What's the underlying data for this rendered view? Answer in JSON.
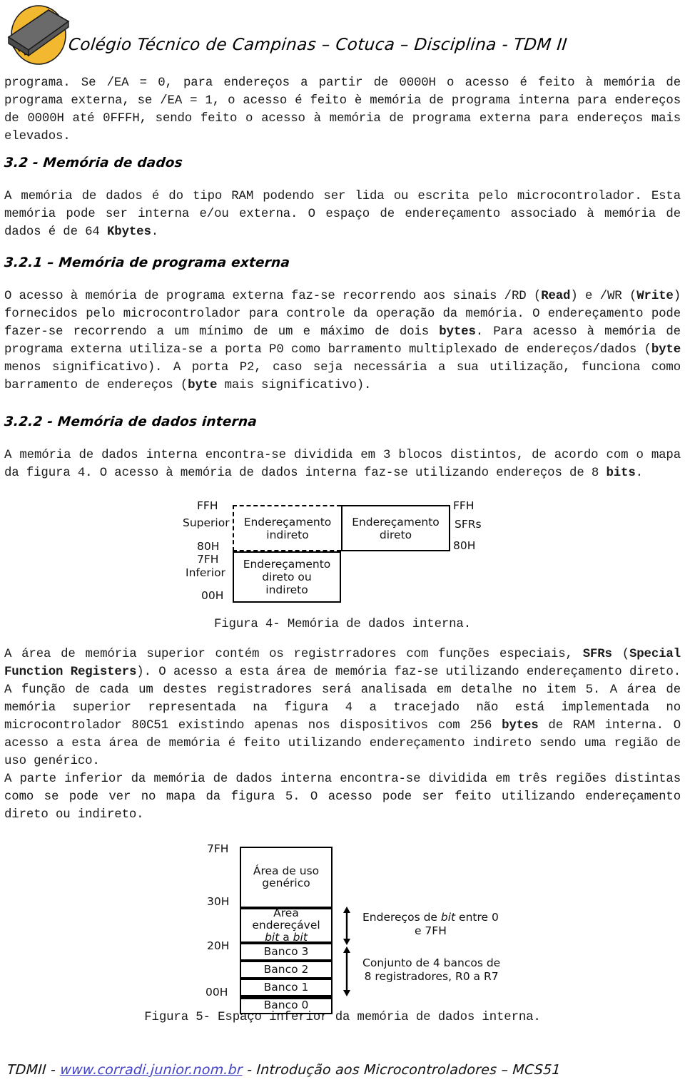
{
  "header": {
    "institution_title": "Colégio Técnico de Campinas – Cotuca – Disciplina - TDM II",
    "logo_icon": "microcontroller-chip-icon",
    "logo_colors": {
      "circle": "#F2B830",
      "chip_body": "#585858",
      "chip_pins": "#FFFFFF"
    }
  },
  "body": {
    "paragraph_1": "programa. Se /EA = 0, para endereços a partir de 0000H o acesso é feito à memória de programa externa, se /EA = 1, o acesso é feito è memória de programa interna para endereços de 0000H até 0FFFH, sendo feito o acesso à memória de programa externa para endereços mais elevados.",
    "section_3_2_heading": "3.2 - Memória de dados",
    "paragraph_2_a": "A memória de dados é do tipo RAM podendo ser lida ou escrita pelo microcontrolador. Esta memória pode ser interna e/ou externa. O espaço de endereçamento associado à memória de dados é de 64 ",
    "paragraph_2_bold": "Kbytes",
    "paragraph_2_b": ".",
    "section_3_2_1_heading": "3.2.1 – Memória de programa externa",
    "paragraph_3_1": "O acesso à memória de programa externa faz-se recorrendo aos sinais /RD (",
    "paragraph_3_b1": "Read",
    "paragraph_3_2": ") e /WR (",
    "paragraph_3_b2": "Write",
    "paragraph_3_3": ") fornecidos pelo microcontrolador para controle da operação da memória. O endereçamento pode fazer-se recorrendo a um mínimo de um e máximo de dois ",
    "paragraph_3_b3": "bytes",
    "paragraph_3_4": ". Para acesso à memória de programa externa utiliza-se a porta P0 como barramento multiplexado de endereços/dados (",
    "paragraph_3_b4": "byte",
    "paragraph_3_5": " menos significativo). A porta P2, caso seja necessária a sua utilização, funciona como barramento de endereços (",
    "paragraph_3_b5": "byte",
    "paragraph_3_6": " mais significativo).",
    "section_3_2_2_heading": "3.2.2 - Memória de dados interna",
    "paragraph_4_1": "A memória de dados interna encontra-se dividida em 3 blocos distintos, de acordo com o mapa da figura 4. O acesso à memória de dados interna faz-se utilizando endereços de 8 ",
    "paragraph_4_b1": "bits",
    "paragraph_4_2": ".",
    "figure_4_caption": "Figura 4- Memória de dados interna.",
    "paragraph_5_1": "A área de memória superior contém os registrradores com funções especiais, ",
    "paragraph_5_b1": "SFRs",
    "paragraph_5_2": " (",
    "paragraph_5_b2": "Special Function Registers",
    "paragraph_5_3": "). O acesso a esta área de memória faz-se utilizando endereçamento direto. A função de cada um destes registradores será analisada em detalhe no item 5. A área de memória superior representada na figura 4 a tracejado não está implementada no microcontrolador 80C51 existindo apenas nos dispositivos com 256 ",
    "paragraph_5_b3": "bytes",
    "paragraph_5_4": " de RAM interna. O acesso a esta área de memória é feito utilizando endereçamento indireto sendo uma região de uso genérico.",
    "paragraph_6": "A parte inferior da memória de dados interna encontra-se dividida em três regiões distintas como se pode ver no mapa da figura 5. O acesso pode ser feito utilizando endereçamento direto ou indireto.",
    "figure_5_caption": "Figura 5- Espaço inferior da memória de dados interna."
  },
  "figure_4": {
    "labels": {
      "top_left_addr": "FFH",
      "superior": "Superior",
      "mid_left_addr": "80H",
      "mid_left_addr_2": "7FH",
      "inferior": "Inferior",
      "bottom_left_addr": "00H",
      "top_right_addr": "FFH",
      "sfrs": "SFRs",
      "bottom_right_addr": "80H"
    },
    "blocks": [
      {
        "id": "indirect-upper",
        "line1": "Endereçamento",
        "line2": "indireto",
        "border": "dashed"
      },
      {
        "id": "direct-sfr",
        "line1": "Endereçamento",
        "line2": "direto",
        "border": "solid"
      },
      {
        "id": "direct-or-indirect-lower",
        "line1": "Endereçamento",
        "line2": "direto ou",
        "line3": "indireto",
        "border": "solid"
      }
    ]
  },
  "figure_5": {
    "addresses": {
      "a_7fh": "7FH",
      "a_30h": "30H",
      "a_20h": "20H",
      "a_00h": "00H"
    },
    "rows": [
      {
        "id": "generic-use-area",
        "line1": "Área de uso",
        "line2": "genérico"
      },
      {
        "id": "bit-addressable-area",
        "line1": "Área endereçável",
        "line2_italic": "bit",
        "line2_mid": " a ",
        "line2_italic2": "bit"
      },
      {
        "id": "bank-3",
        "label": "Banco 3"
      },
      {
        "id": "bank-2",
        "label": "Banco 2"
      },
      {
        "id": "bank-1",
        "label": "Banco 1"
      },
      {
        "id": "bank-0",
        "label": "Banco 0"
      }
    ],
    "annotations": [
      {
        "id": "bit-address-range",
        "line1_a": "Endereços de ",
        "line1_italic": "bit",
        "line1_b": " entre 0",
        "line2": "e 7FH"
      },
      {
        "id": "register-banks-note",
        "line1": "Conjunto de 4 bancos de",
        "line2": "8 registradores, R0 a R7"
      }
    ]
  },
  "footer": {
    "prefix": "TDMII - ",
    "link": "www.corradi.junior.nom.br",
    "suffix": " - Introdução aos Microcontroladores – MCS51",
    "link_color": "#4040c8"
  }
}
